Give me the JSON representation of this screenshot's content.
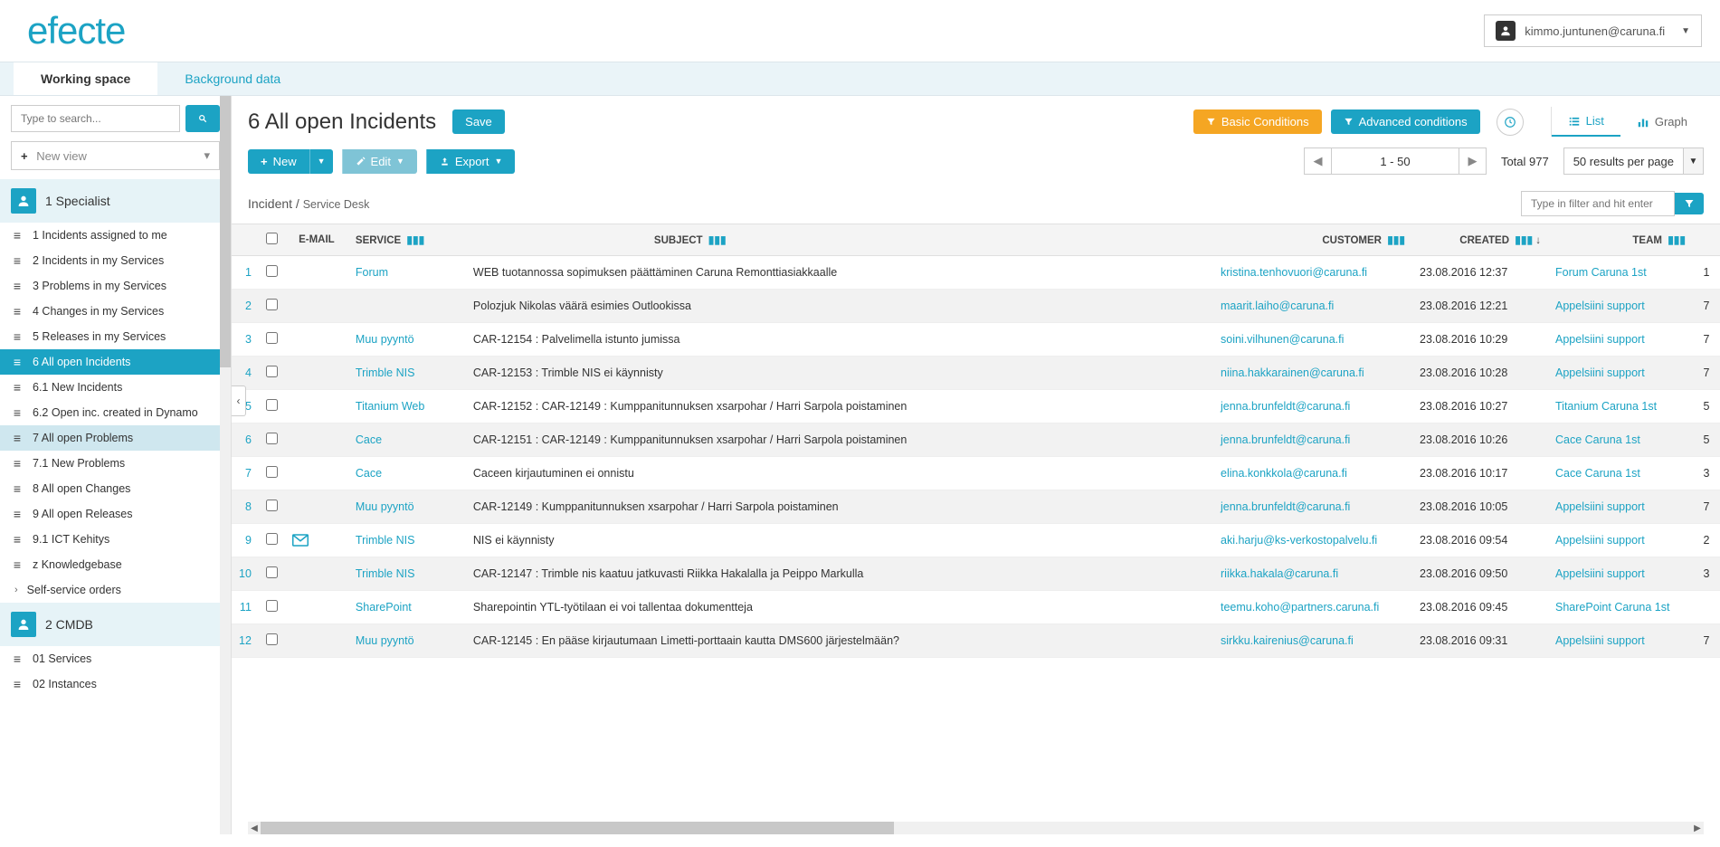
{
  "header": {
    "logo": "efecte",
    "user_email": "kimmo.juntunen@caruna.fi"
  },
  "tabs": {
    "working_space": "Working space",
    "background_data": "Background data"
  },
  "sidebar": {
    "search_placeholder": "Type to search...",
    "new_view": "New view",
    "sections": [
      {
        "title": "1 Specialist",
        "items": [
          {
            "label": "1 Incidents assigned to me",
            "icon": "≡"
          },
          {
            "label": "2 Incidents in my Services",
            "icon": "≡"
          },
          {
            "label": "3 Problems in my Services",
            "icon": "≡"
          },
          {
            "label": "4 Changes in my Services",
            "icon": "≡"
          },
          {
            "label": "5 Releases in my Services",
            "icon": "≡"
          },
          {
            "label": "6 All open Incidents",
            "icon": "≡",
            "active": true
          },
          {
            "label": "6.1 New Incidents",
            "icon": "≡"
          },
          {
            "label": "6.2 Open inc. created in Dynamo",
            "icon": "≡"
          },
          {
            "label": "7 All open Problems",
            "icon": "≡",
            "hover": true
          },
          {
            "label": "7.1 New Problems",
            "icon": "≡"
          },
          {
            "label": "8 All open Changes",
            "icon": "≡"
          },
          {
            "label": "9 All open Releases",
            "icon": "≡"
          },
          {
            "label": "9.1 ICT Kehitys",
            "icon": "≡"
          },
          {
            "label": "z Knowledgebase",
            "icon": "≡"
          },
          {
            "label": "Self-service orders",
            "icon": "›",
            "chevron": true
          }
        ]
      },
      {
        "title": "2 CMDB",
        "items": [
          {
            "label": "01 Services",
            "icon": "≡"
          },
          {
            "label": "02 Instances",
            "icon": "≡"
          }
        ]
      }
    ]
  },
  "content": {
    "title": "6 All open Incidents",
    "save": "Save",
    "basic_conditions": "Basic Conditions",
    "advanced_conditions": "Advanced conditions",
    "view_list": "List",
    "view_graph": "Graph",
    "new": "New",
    "edit": "Edit",
    "export": "Export",
    "page_range": "1 - 50",
    "total": "Total 977",
    "per_page": "50 results per page",
    "breadcrumb_main": "Incident",
    "breadcrumb_sep": " / ",
    "breadcrumb_sub": "Service Desk",
    "filter_placeholder": "Type in filter and hit enter"
  },
  "table": {
    "headers": {
      "email": "E-MAIL",
      "service": "SERVICE",
      "subject": "SUBJECT",
      "customer": "CUSTOMER",
      "created": "CREATED",
      "team": "TEAM"
    },
    "rows": [
      {
        "n": 1,
        "email": "",
        "service": "Forum",
        "subject": "WEB tuotannossa sopimuksen päättäminen Caruna Remonttiasiakkaalle",
        "customer": "kristina.tenhovuori@caruna.fi",
        "created": "23.08.2016 12:37",
        "team": "Forum Caruna 1st",
        "last": "1"
      },
      {
        "n": 2,
        "email": "",
        "service": "",
        "subject": "Polozjuk Nikolas väärä esimies Outlookissa",
        "customer": "maarit.laiho@caruna.fi",
        "created": "23.08.2016 12:21",
        "team": "Appelsiini support",
        "last": "7"
      },
      {
        "n": 3,
        "email": "",
        "service": "Muu pyyntö",
        "subject": "CAR-12154 : Palvelimella istunto jumissa",
        "customer": "soini.vilhunen@caruna.fi",
        "created": "23.08.2016 10:29",
        "team": "Appelsiini support",
        "last": "7"
      },
      {
        "n": 4,
        "email": "",
        "service": "Trimble NIS",
        "subject": "CAR-12153 : Trimble NIS ei käynnisty",
        "customer": "niina.hakkarainen@caruna.fi",
        "created": "23.08.2016 10:28",
        "team": "Appelsiini support",
        "last": "7"
      },
      {
        "n": 5,
        "email": "",
        "service": "Titanium Web",
        "subject": "CAR-12152 : CAR-12149 : Kumppanitunnuksen xsarpohar / Harri Sarpola poistaminen",
        "customer": "jenna.brunfeldt@caruna.fi",
        "created": "23.08.2016 10:27",
        "team": "Titanium Caruna 1st",
        "last": "5"
      },
      {
        "n": 6,
        "email": "",
        "service": "Cace",
        "subject": "CAR-12151 : CAR-12149 : Kumppanitunnuksen xsarpohar / Harri Sarpola poistaminen",
        "customer": "jenna.brunfeldt@caruna.fi",
        "created": "23.08.2016 10:26",
        "team": "Cace Caruna 1st",
        "last": "5"
      },
      {
        "n": 7,
        "email": "",
        "service": "Cace",
        "subject": "Caceen kirjautuminen ei onnistu",
        "customer": "elina.konkkola@caruna.fi",
        "created": "23.08.2016 10:17",
        "team": "Cace Caruna 1st",
        "last": "3"
      },
      {
        "n": 8,
        "email": "",
        "service": "Muu pyyntö",
        "subject": "CAR-12149 : Kumppanitunnuksen xsarpohar / Harri Sarpola poistaminen",
        "customer": "jenna.brunfeldt@caruna.fi",
        "created": "23.08.2016 10:05",
        "team": "Appelsiini support",
        "last": "7"
      },
      {
        "n": 9,
        "email": "✉",
        "service": "Trimble NIS",
        "subject": "NIS ei käynnisty",
        "customer": "aki.harju@ks-verkostopalvelu.fi",
        "created": "23.08.2016 09:54",
        "team": "Appelsiini support",
        "last": "2"
      },
      {
        "n": 10,
        "email": "",
        "service": "Trimble NIS",
        "subject": "CAR-12147 : Trimble nis kaatuu jatkuvasti Riikka Hakalalla ja Peippo Markulla",
        "customer": "riikka.hakala@caruna.fi",
        "created": "23.08.2016 09:50",
        "team": "Appelsiini support",
        "last": "3"
      },
      {
        "n": 11,
        "email": "",
        "service": "SharePoint",
        "subject": "Sharepointin YTL-työtilaan ei voi tallentaa dokumentteja",
        "customer": "teemu.koho@partners.caruna.fi",
        "created": "23.08.2016 09:45",
        "team": "SharePoint Caruna 1st",
        "last": ""
      },
      {
        "n": 12,
        "email": "",
        "service": "Muu pyyntö",
        "subject": "CAR-12145 : En pääse kirjautumaan Limetti-porttaain kautta DMS600 järjestelmään?",
        "customer": "sirkku.kairenius@caruna.fi",
        "created": "23.08.2016 09:31",
        "team": "Appelsiini support",
        "last": "7"
      }
    ]
  }
}
